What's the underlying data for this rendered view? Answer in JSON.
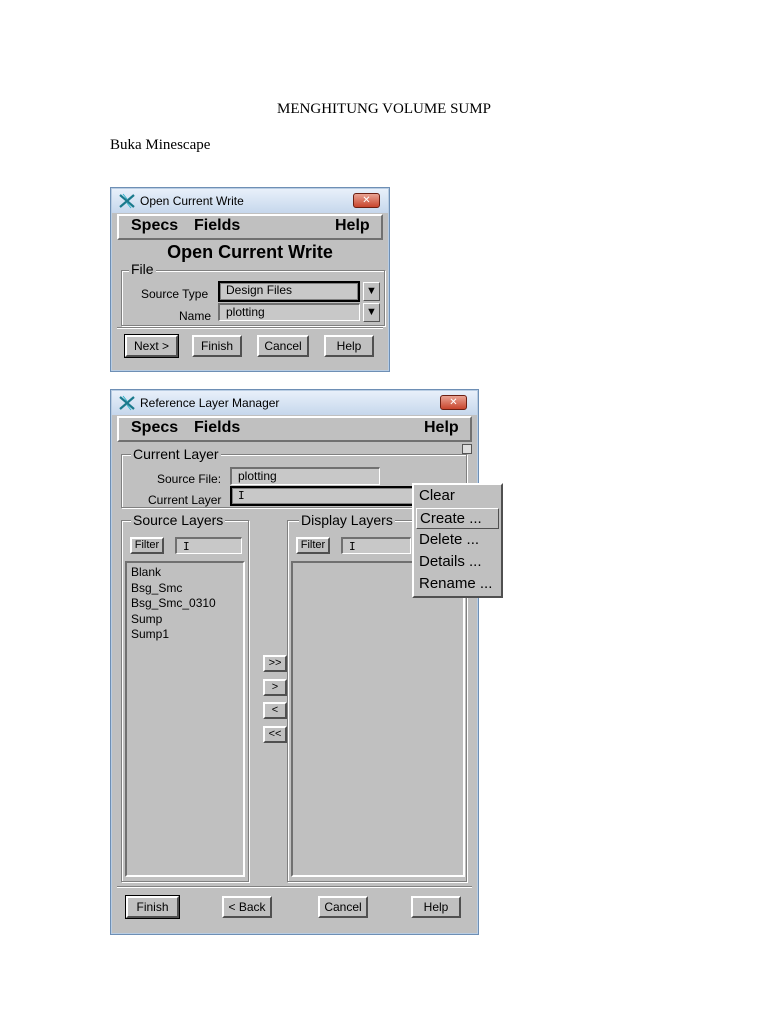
{
  "document": {
    "title": "MENGHITUNG VOLUME SUMP",
    "paragraph": "Buka Minescape"
  },
  "window1": {
    "title": "Open Current Write",
    "close": "✕",
    "menu": {
      "specs": "Specs",
      "fields": "Fields",
      "help": "Help"
    },
    "heading": "Open Current Write",
    "group_label": "File",
    "source_type_label": "Source Type",
    "source_type_value": "Design Files",
    "name_label": "Name",
    "name_value": "plotting",
    "dropdown_arrow": "▼",
    "buttons": {
      "next": "Next >",
      "finish": "Finish",
      "cancel": "Cancel",
      "help": "Help"
    }
  },
  "window2": {
    "title": "Reference Layer Manager",
    "close": "✕",
    "menu": {
      "specs": "Specs",
      "fields": "Fields",
      "help": "Help"
    },
    "current_layer_group": "Current Layer",
    "source_file_label": "Source File:",
    "source_file_value": "plotting",
    "current_layer_label": "Current Layer",
    "source_layers_group": "Source Layers",
    "display_layers_group": "Display Layers",
    "filter_label": "Filter",
    "source_layers": [
      "Blank",
      "Bsg_Smc",
      "Bsg_Smc_0310",
      "Sump",
      "Sump1"
    ],
    "transfer_buttons": [
      ">>",
      ">",
      "<",
      "<<"
    ],
    "buttons": {
      "finish": "Finish",
      "back": "< Back",
      "cancel": "Cancel",
      "help": "Help"
    },
    "popup_menu": [
      "Clear",
      "Create ...",
      "Delete ...",
      "Details ...",
      "Rename ..."
    ],
    "popup_highlighted": "Create ..."
  },
  "colors": {
    "window_bg": "#c0c0c0",
    "titlebar": "#c6d7ec",
    "close_button": "#c8452d",
    "icon_accent": "#1a7a8c"
  }
}
